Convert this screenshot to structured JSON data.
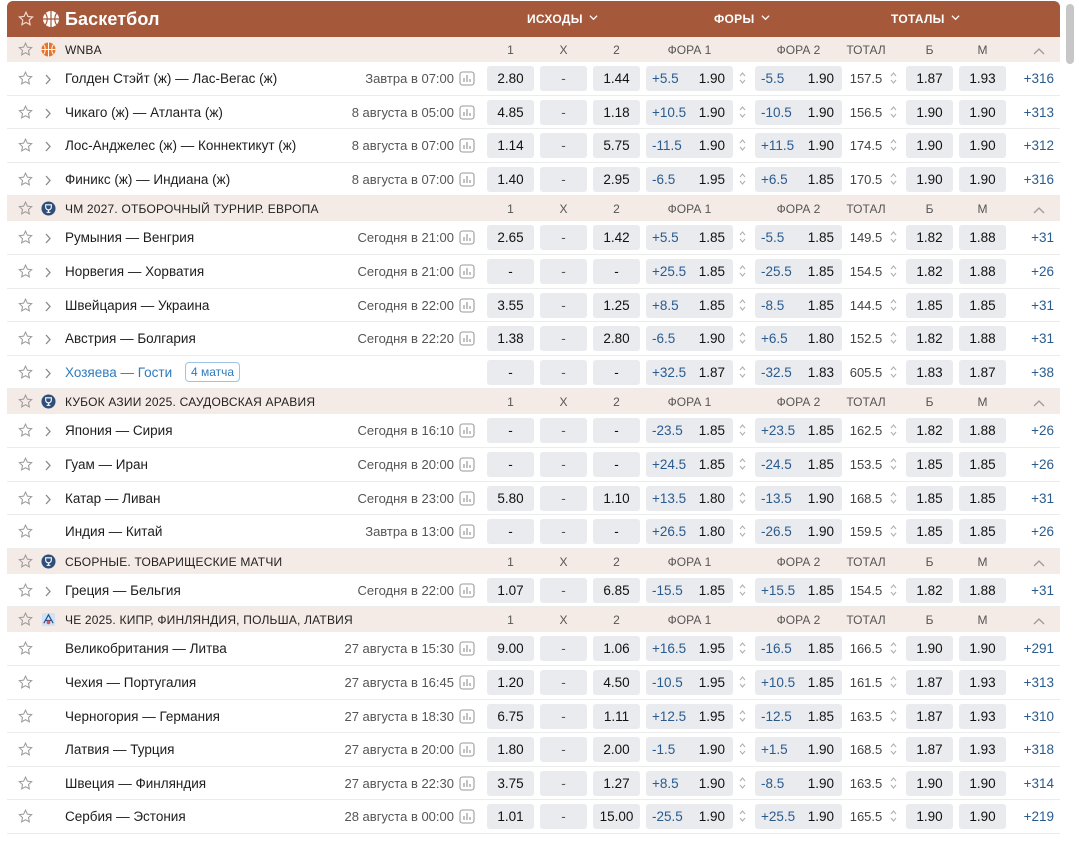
{
  "header": {
    "title": "Баскетбол",
    "outcomes_label": "ИСХОДЫ",
    "handicaps_label": "ФОРЫ",
    "totals_label": "ТОТАЛЫ"
  },
  "columns": {
    "c1": "1",
    "cx": "X",
    "c2": "2",
    "f1": "ФОРА 1",
    "f2": "ФОРА 2",
    "total": "ТОТАЛ",
    "b": "Б",
    "m": "М"
  },
  "colors": {
    "header_bg": "#a5583a",
    "league_bg": "#f5ebe6",
    "cell_bg": "#e9ebee",
    "link": "#2f7bbf"
  },
  "leagues": [
    {
      "name": "WNBA",
      "icon": "basketball-icon",
      "events": [
        {
          "teams": "Голден Стэйт (ж) — Лас-Вегас (ж)",
          "date": "Завтра в 07:00",
          "o1": "2.80",
          "ox": "-",
          "o2": "1.44",
          "h1": "+5.5",
          "h1o": "1.90",
          "h2": "-5.5",
          "h2o": "1.90",
          "total": "157.5",
          "b": "1.87",
          "m": "1.93",
          "more": "+316"
        },
        {
          "teams": "Чикаго (ж) — Атланта (ж)",
          "date": "8 августа в 05:00",
          "o1": "4.85",
          "ox": "-",
          "o2": "1.18",
          "h1": "+10.5",
          "h1o": "1.90",
          "h2": "-10.5",
          "h2o": "1.90",
          "total": "156.5",
          "b": "1.90",
          "m": "1.90",
          "more": "+313"
        },
        {
          "teams": "Лос-Анджелес (ж) — Коннектикут (ж)",
          "date": "8 августа в 07:00",
          "o1": "1.14",
          "ox": "-",
          "o2": "5.75",
          "h1": "-11.5",
          "h1o": "1.90",
          "h2": "+11.5",
          "h2o": "1.90",
          "total": "174.5",
          "b": "1.90",
          "m": "1.90",
          "more": "+312"
        },
        {
          "teams": "Финикс (ж) — Индиана (ж)",
          "date": "8 августа в 07:00",
          "o1": "1.40",
          "ox": "-",
          "o2": "2.95",
          "h1": "-6.5",
          "h1o": "1.95",
          "h2": "+6.5",
          "h2o": "1.85",
          "total": "170.5",
          "b": "1.90",
          "m": "1.90",
          "more": "+316"
        }
      ]
    },
    {
      "name": "ЧМ 2027. ОТБОРОЧНЫЙ ТУРНИР. ЕВРОПА",
      "icon": "trophy-icon",
      "events": [
        {
          "teams": "Румыния — Венгрия",
          "date": "Сегодня в 21:00",
          "o1": "2.65",
          "ox": "-",
          "o2": "1.42",
          "h1": "+5.5",
          "h1o": "1.85",
          "h2": "-5.5",
          "h2o": "1.85",
          "total": "149.5",
          "b": "1.82",
          "m": "1.88",
          "more": "+31"
        },
        {
          "teams": "Норвегия — Хорватия",
          "date": "Сегодня в 21:00",
          "o1": "-",
          "ox": "-",
          "o2": "-",
          "h1": "+25.5",
          "h1o": "1.85",
          "h2": "-25.5",
          "h2o": "1.85",
          "total": "154.5",
          "b": "1.82",
          "m": "1.88",
          "more": "+26"
        },
        {
          "teams": "Швейцария — Украина",
          "date": "Сегодня в 22:00",
          "o1": "3.55",
          "ox": "-",
          "o2": "1.25",
          "h1": "+8.5",
          "h1o": "1.85",
          "h2": "-8.5",
          "h2o": "1.85",
          "total": "144.5",
          "b": "1.85",
          "m": "1.85",
          "more": "+31"
        },
        {
          "teams": "Австрия — Болгария",
          "date": "Сегодня в 22:20",
          "o1": "1.38",
          "ox": "-",
          "o2": "2.80",
          "h1": "-6.5",
          "h1o": "1.90",
          "h2": "+6.5",
          "h2o": "1.80",
          "total": "152.5",
          "b": "1.82",
          "m": "1.88",
          "more": "+31"
        },
        {
          "teams": "Хозяева — Гости",
          "link": true,
          "badge": "4 матча",
          "date": "",
          "o1": "-",
          "ox": "-",
          "o2": "-",
          "h1": "+32.5",
          "h1o": "1.87",
          "h2": "-32.5",
          "h2o": "1.83",
          "total": "605.5",
          "b": "1.83",
          "m": "1.87",
          "more": "+38"
        }
      ]
    },
    {
      "name": "КУБОК АЗИИ 2025. САУДОВСКАЯ АРАВИЯ",
      "icon": "trophy-icon",
      "events": [
        {
          "teams": "Япония — Сирия",
          "date": "Сегодня в 16:10",
          "o1": "-",
          "ox": "-",
          "o2": "-",
          "h1": "-23.5",
          "h1o": "1.85",
          "h2": "+23.5",
          "h2o": "1.85",
          "total": "162.5",
          "b": "1.82",
          "m": "1.88",
          "more": "+26"
        },
        {
          "teams": "Гуам — Иран",
          "date": "Сегодня в 20:00",
          "o1": "-",
          "ox": "-",
          "o2": "-",
          "h1": "+24.5",
          "h1o": "1.85",
          "h2": "-24.5",
          "h2o": "1.85",
          "total": "153.5",
          "b": "1.85",
          "m": "1.85",
          "more": "+26"
        },
        {
          "teams": "Катар — Ливан",
          "date": "Сегодня в 23:00",
          "o1": "5.80",
          "ox": "-",
          "o2": "1.10",
          "h1": "+13.5",
          "h1o": "1.80",
          "h2": "-13.5",
          "h2o": "1.90",
          "total": "168.5",
          "b": "1.85",
          "m": "1.85",
          "more": "+31"
        },
        {
          "teams": "Индия — Китай",
          "noexpand": true,
          "date": "Завтра в 13:00",
          "o1": "-",
          "ox": "-",
          "o2": "-",
          "h1": "+26.5",
          "h1o": "1.80",
          "h2": "-26.5",
          "h2o": "1.90",
          "total": "159.5",
          "b": "1.85",
          "m": "1.85",
          "more": "+26"
        }
      ]
    },
    {
      "name": "СБОРНЫЕ. ТОВАРИЩЕСКИЕ МАТЧИ",
      "icon": "trophy-icon",
      "events": [
        {
          "teams": "Греция — Бельгия",
          "date": "Сегодня в 22:00",
          "o1": "1.07",
          "ox": "-",
          "o2": "6.85",
          "h1": "-15.5",
          "h1o": "1.85",
          "h2": "+15.5",
          "h2o": "1.85",
          "total": "154.5",
          "b": "1.82",
          "m": "1.88",
          "more": "+31"
        }
      ]
    },
    {
      "name": "ЧЕ 2025. КИПР, ФИНЛЯНДИЯ, ПОЛЬША, ЛАТВИЯ",
      "icon": "eurobasket-icon",
      "events": [
        {
          "teams": "Великобритания — Литва",
          "noexpand": true,
          "date": "27 августа в 15:30",
          "o1": "9.00",
          "ox": "-",
          "o2": "1.06",
          "h1": "+16.5",
          "h1o": "1.95",
          "h2": "-16.5",
          "h2o": "1.85",
          "total": "166.5",
          "b": "1.90",
          "m": "1.90",
          "more": "+291"
        },
        {
          "teams": "Чехия — Португалия",
          "noexpand": true,
          "date": "27 августа в 16:45",
          "o1": "1.20",
          "ox": "-",
          "o2": "4.50",
          "h1": "-10.5",
          "h1o": "1.95",
          "h2": "+10.5",
          "h2o": "1.85",
          "total": "161.5",
          "b": "1.87",
          "m": "1.93",
          "more": "+313"
        },
        {
          "teams": "Черногория — Германия",
          "noexpand": true,
          "date": "27 августа в 18:30",
          "o1": "6.75",
          "ox": "-",
          "o2": "1.11",
          "h1": "+12.5",
          "h1o": "1.95",
          "h2": "-12.5",
          "h2o": "1.85",
          "total": "163.5",
          "b": "1.87",
          "m": "1.93",
          "more": "+310"
        },
        {
          "teams": "Латвия — Турция",
          "noexpand": true,
          "date": "27 августа в 20:00",
          "o1": "1.80",
          "ox": "-",
          "o2": "2.00",
          "h1": "-1.5",
          "h1o": "1.90",
          "h2": "+1.5",
          "h2o": "1.90",
          "total": "168.5",
          "b": "1.87",
          "m": "1.93",
          "more": "+318"
        },
        {
          "teams": "Швеция — Финляндия",
          "noexpand": true,
          "date": "27 августа в 22:30",
          "o1": "3.75",
          "ox": "-",
          "o2": "1.27",
          "h1": "+8.5",
          "h1o": "1.90",
          "h2": "-8.5",
          "h2o": "1.90",
          "total": "163.5",
          "b": "1.90",
          "m": "1.90",
          "more": "+314"
        },
        {
          "teams": "Сербия — Эстония",
          "noexpand": true,
          "date": "28 августа в 00:00",
          "o1": "1.01",
          "ox": "-",
          "o2": "15.00",
          "h1": "-25.5",
          "h1o": "1.90",
          "h2": "+25.5",
          "h2o": "1.90",
          "total": "165.5",
          "b": "1.90",
          "m": "1.90",
          "more": "+219"
        }
      ]
    }
  ]
}
